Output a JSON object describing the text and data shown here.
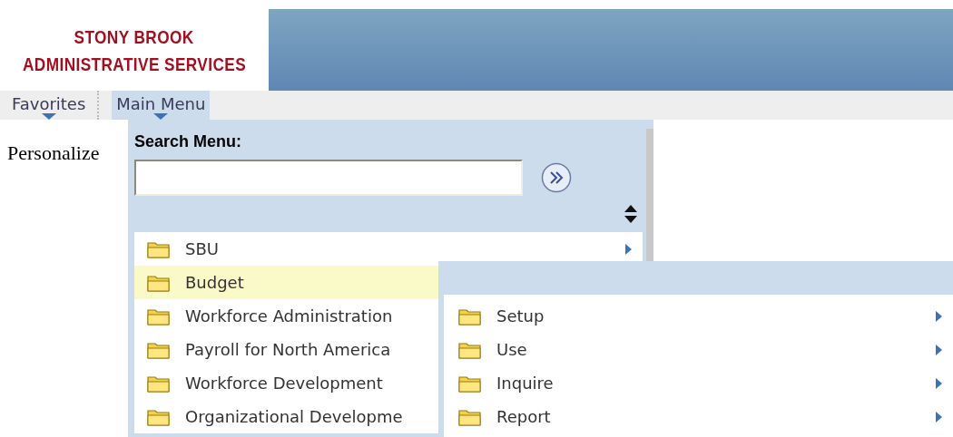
{
  "logo": {
    "line_1": "STONY BROOK",
    "line_2": "ADMINISTRATIVE SERVICES"
  },
  "nav": [
    {
      "label": "Favorites",
      "selected": false
    },
    {
      "label": "Main Menu",
      "selected": true
    }
  ],
  "page_text": "Personalize",
  "main_menu": {
    "search_label": "Search Menu:",
    "items": [
      {
        "label": "SBU",
        "selected": false
      },
      {
        "label": "Budget",
        "selected": true
      },
      {
        "label": "Workforce Administration",
        "selected": false
      },
      {
        "label": "Payroll for North America",
        "selected": false
      },
      {
        "label": "Workforce Development",
        "selected": false
      },
      {
        "label": "Organizational Developme",
        "selected": false
      }
    ]
  },
  "submenu": {
    "items": [
      {
        "label": "Setup",
        "arrow": true
      },
      {
        "label": "Use",
        "arrow": true
      },
      {
        "label": "Inquire",
        "arrow": true
      },
      {
        "label": "Report",
        "arrow": true
      }
    ]
  }
}
